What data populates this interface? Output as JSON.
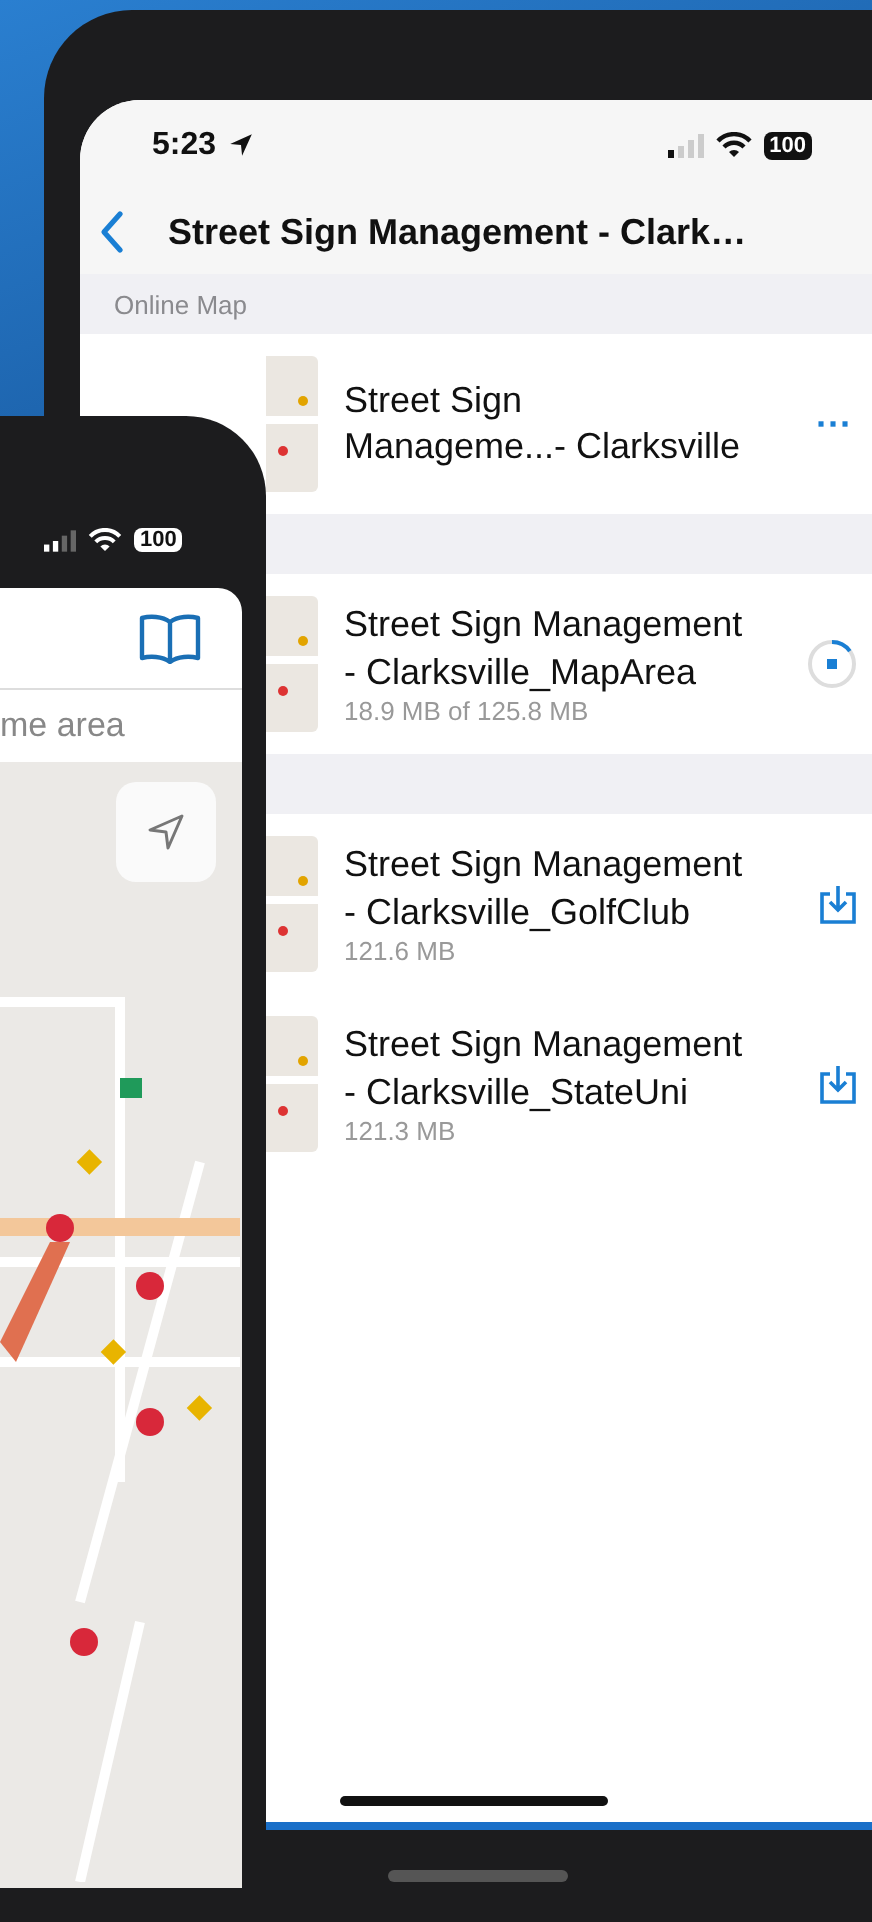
{
  "back_phone": {
    "status_bar": {
      "time": "5:23",
      "battery": "100"
    },
    "nav": {
      "title": "Street Sign Management - Clark…"
    },
    "sections": [
      {
        "header": "Online Map",
        "items": [
          {
            "title": "Street Sign Manageme...- Clarksville",
            "kind": "more",
            "action": "···"
          }
        ]
      },
      {
        "items": [
          {
            "title": "Street Sign Management - Clarksville_MapArea",
            "size": "18.9 MB of 125.8 MB",
            "kind": "downloading",
            "level": 0.15
          }
        ]
      },
      {
        "items": [
          {
            "title": "Street Sign Management - Clarksville_GolfClub",
            "size": "121.6 MB",
            "kind": "download"
          },
          {
            "title": "Street Sign Management - Clarksville_StateUni",
            "size": "121.3 MB",
            "kind": "download"
          }
        ]
      }
    ]
  },
  "front_phone": {
    "status_bar": {
      "battery": "100"
    },
    "search": {
      "placeholder": "me area"
    }
  }
}
